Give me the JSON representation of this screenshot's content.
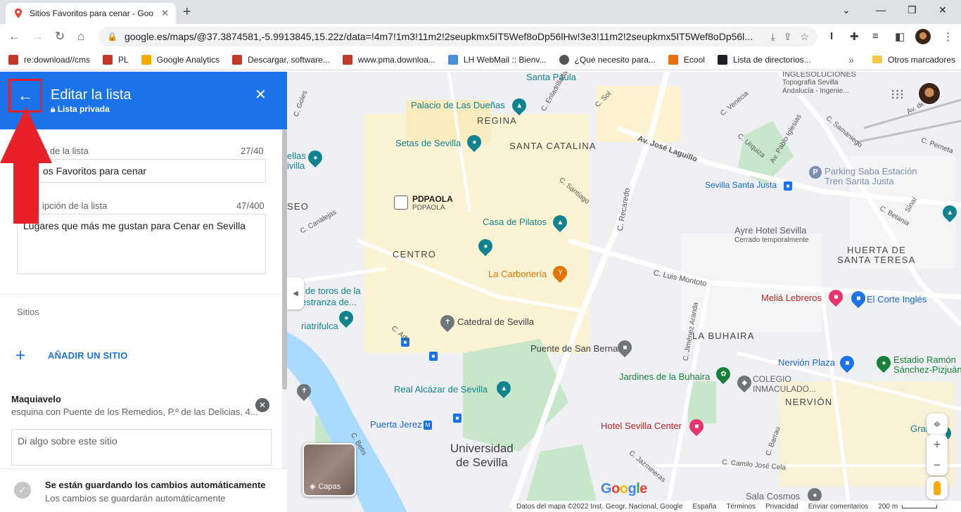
{
  "browser": {
    "tab_title": "Sitios Favoritos para cenar - Goo",
    "new_tab": "+",
    "url": "google.es/maps/@37.3874581,-5.9913845,15.22z/data=!4m7!1m3!11m2!2seupkmx5IT5Wef8oDp56lHw!3e3!11m2!2seupkmx5IT5Wef8oDp56l...",
    "bookmarks": [
      {
        "label": "re:download//cms",
        "color": "#c0392b"
      },
      {
        "label": "PL",
        "color": "#c0392b"
      },
      {
        "label": "Google Analytics",
        "color": "#f9ab00"
      },
      {
        "label": "Descargar, software...",
        "color": "#c0392b"
      },
      {
        "label": "www.pma.downloa...",
        "color": "#c0392b"
      },
      {
        "label": "LH WebMail :: Bienv...",
        "color": "#4a90d9"
      },
      {
        "label": "¿Qué necesito para...",
        "color": "#555555"
      },
      {
        "label": "Ecool",
        "color": "#e8710a"
      },
      {
        "label": "Lista de directorios...",
        "color": "#202124"
      }
    ],
    "bookmarks_more": "»",
    "other_bookmarks": "Otros marcadores"
  },
  "sidebar": {
    "title": "Editar la lista",
    "subtitle": "Lista privada",
    "name_label": "e de la lista",
    "name_count": "27/40",
    "name_value": "os Favoritos para cenar",
    "desc_label": "ipción de la lista",
    "desc_count": "47/400",
    "desc_value": "Lugares que más me gustan para Cenar en Sevilla",
    "places_label": "Sitios",
    "add_place": "AÑADIR UN SITIO",
    "place_name": "Maquiavelo",
    "place_address": "esquina con Puente de los Remedios, P.º de las Delicias, 4...",
    "note_placeholder": "Di algo sobre este sitio",
    "save_title": "Se están guardando los cambios automáticamente",
    "save_sub": "Los cambios se guardarán automáticamente"
  },
  "map": {
    "areas": [
      "REGINA",
      "SANTA CATALINA",
      "CENTRO",
      "LA BUHAIRA",
      "NERVIÓN",
      "HUERTA DE",
      "SANTA TERESA",
      "SEO"
    ],
    "pois": {
      "santa_paula": "Santa Paula",
      "palacio": "Palacio de Las Dueñas",
      "setas": "Setas de Sevilla",
      "pdpaola": "PDPAOLA",
      "pdpaola_sub": "PDPAOLA",
      "casa_pilatos": "Casa de Pilatos",
      "carboneria": "La Carbonería",
      "toros_1": "de toros de la",
      "toros_2": "estranza de...",
      "catedral": "Catedral de Sevilla",
      "puente_sb": "Puente de San Bernardo",
      "alcazar": "Real Alcázar de Sevilla",
      "puerta_jerez": "Puerta Jerez",
      "universidad_1": "Universidad",
      "universidad_2": "de Sevilla",
      "jardines": "Jardines de la Buhaira",
      "colegio_1": "COLEGIO",
      "colegio_2": "INMACULADO...",
      "nervion_plaza": "Nervión Plaza",
      "hotel_center": "Hotel Sevilla Center",
      "melia": "Meliá Lebreros",
      "corte_ingles": "El Corte Inglés",
      "estadio_1": "Estadio Ramón",
      "estadio_2": "Sánchez-Pizjuán",
      "ayre_1": "Ayre Hotel Sevilla",
      "ayre_2": "Cerrado temporalmente",
      "santa_justa": "Sevilla Santa Justa",
      "parking_1": "Parking Saba Estación",
      "parking_2": "Tren Santa Justa",
      "inglesoluciones_1": "INGLESOLUCIONES",
      "inglesoluciones_2": "Topografía Sevilla",
      "inglesoluciones_3": "Andalucía - Ingenie...",
      "sala_cosmos": "Sala Cosmos",
      "gran_p": "Gran P",
      "ellas_1": "ellas",
      "ellas_2": "ivilla",
      "triatrifulca": "riatrifulca"
    },
    "streets": {
      "luis_montoto": "C. Luis Montoto",
      "jose_laguillo": "Av. José Laguillo",
      "recaredo": "C. Recaredo",
      "av_top": "Av. de",
      "sol": "C. Sol",
      "santiago": "C. Santiago",
      "venecia": "C. Venecia",
      "urquiza": "C. Urquiza",
      "pablo_iglesias": "Av. Pablo Iglesias",
      "samaniego": "C. Samaniego",
      "perneta": "C. Perneta",
      "canalejas": "C. Canalejas",
      "arfe": "C. Arfe",
      "jimenez_aranda": "C. Jiménez Aranda",
      "jazmineras": "C. Jazmineras",
      "camilo_jose_cela": "C. Camilo José Cela",
      "barrau": "C. Barrau",
      "betania": "C. Betania",
      "goles": "C. Goles",
      "sinai": "Sinaí",
      "betis": "C. Betis",
      "enladrillada": "C. Enladrillada"
    },
    "layers_label": "Capas",
    "google": "Google",
    "footer": {
      "data": "Datos del mapa ©2022 Inst. Geogr. Nacional, Google",
      "country": "España",
      "terms": "Términos",
      "privacy": "Privacidad",
      "feedback": "Enviar comentarios",
      "scale": "200 m"
    },
    "colors": {
      "water": "#aadaff",
      "park": "#c8e6c9",
      "block": "#fdf3d0",
      "road": "#ffffff"
    }
  }
}
